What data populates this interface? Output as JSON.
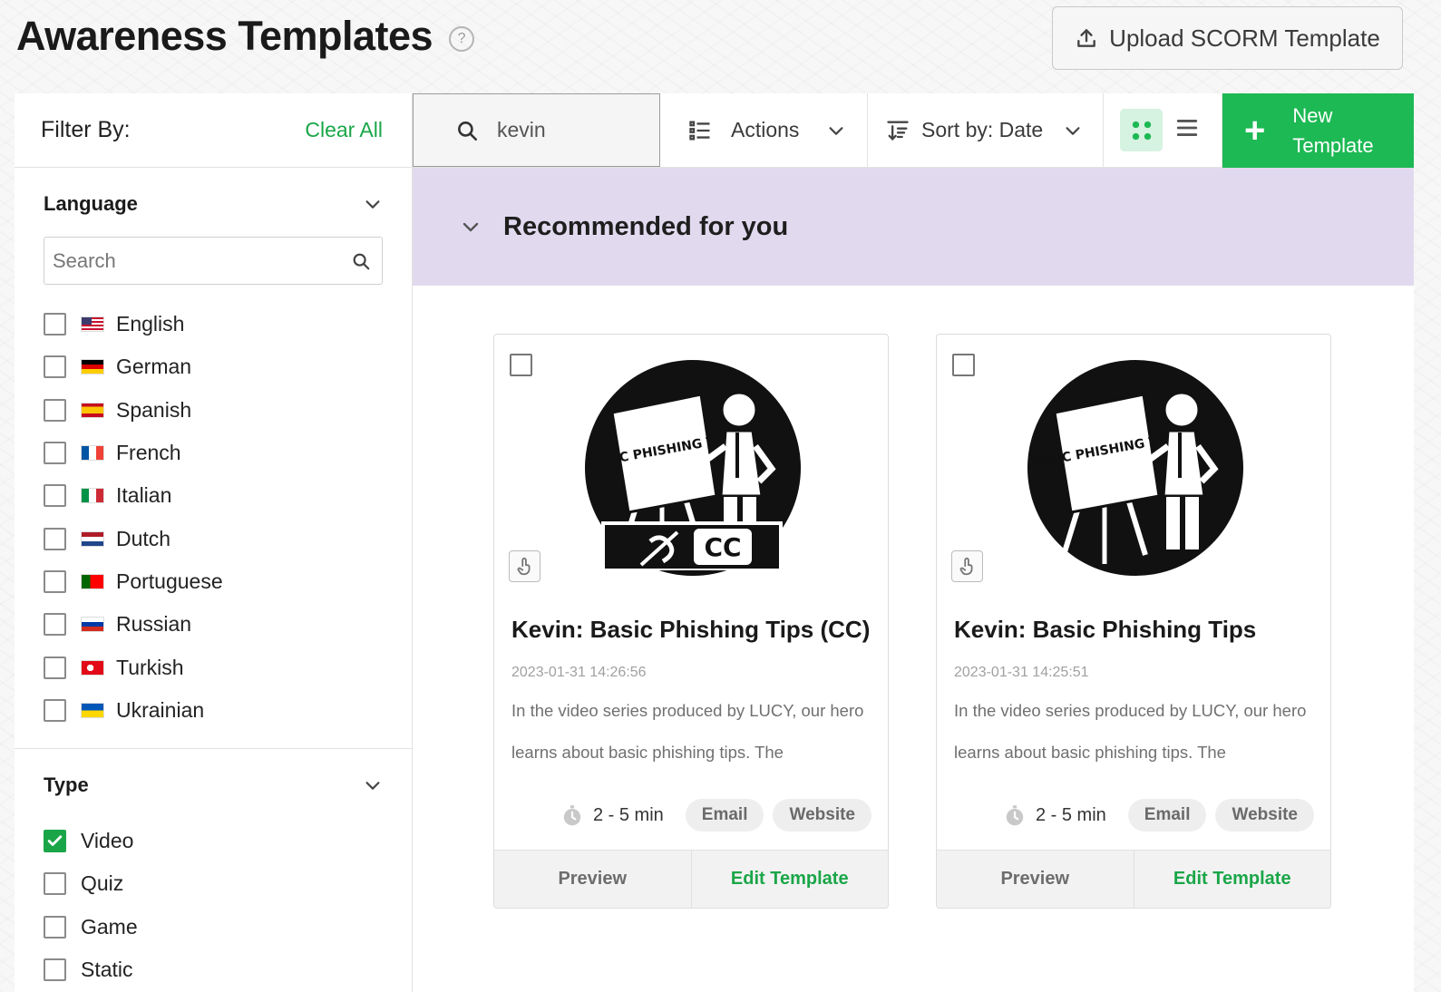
{
  "page": {
    "title": "Awareness Templates",
    "help_icon": "question-mark",
    "upload_button": "Upload SCORM Template"
  },
  "sidebar": {
    "filter_label": "Filter By:",
    "clear_all": "Clear All",
    "language": {
      "title": "Language",
      "search_placeholder": "Search",
      "items": [
        {
          "label": "English",
          "flag": "us",
          "checked": false
        },
        {
          "label": "German",
          "flag": "de",
          "checked": false
        },
        {
          "label": "Spanish",
          "flag": "es",
          "checked": false
        },
        {
          "label": "French",
          "flag": "fr",
          "checked": false
        },
        {
          "label": "Italian",
          "flag": "it",
          "checked": false
        },
        {
          "label": "Dutch",
          "flag": "nl",
          "checked": false
        },
        {
          "label": "Portuguese",
          "flag": "pt",
          "checked": false
        },
        {
          "label": "Russian",
          "flag": "ru",
          "checked": false
        },
        {
          "label": "Turkish",
          "flag": "tr",
          "checked": false
        },
        {
          "label": "Ukrainian",
          "flag": "ua",
          "checked": false
        }
      ]
    },
    "type": {
      "title": "Type",
      "items": [
        {
          "label": "Video",
          "checked": true
        },
        {
          "label": "Quiz",
          "checked": false
        },
        {
          "label": "Game",
          "checked": false
        },
        {
          "label": "Static",
          "checked": false
        }
      ]
    }
  },
  "toolbar": {
    "search_value": "kevin",
    "actions_label": "Actions",
    "sort_label": "Sort by: Date",
    "view_mode": "grid",
    "new_template_label": "New Template"
  },
  "section": {
    "title": "Recommended for you"
  },
  "cards": [
    {
      "title": "Kevin: Basic Phishing Tips (CC)",
      "date": "2023-01-31 14:26:56",
      "description": "In the video series produced by LUCY, our hero learns about basic phishing tips. The",
      "duration": "2 - 5 min",
      "tags": [
        "Email",
        "Website"
      ],
      "preview_label": "Preview",
      "edit_label": "Edit Template",
      "has_cc_banner": true,
      "thumb_sign_text": "BASIC PHISHING TIPS",
      "cc_text": "CC"
    },
    {
      "title": "Kevin: Basic Phishing Tips",
      "date": "2023-01-31 14:25:51",
      "description": "In the video series produced by LUCY, our hero learns about basic phishing tips. The",
      "duration": "2 - 5 min",
      "tags": [
        "Email",
        "Website"
      ],
      "preview_label": "Preview",
      "edit_label": "Edit Template",
      "has_cc_banner": false,
      "thumb_sign_text": "BASIC PHISHING TIPS"
    }
  ],
  "colors": {
    "accent": "#1db954",
    "accent_text": "#1aa648",
    "recommended_band": "#e1daef"
  }
}
